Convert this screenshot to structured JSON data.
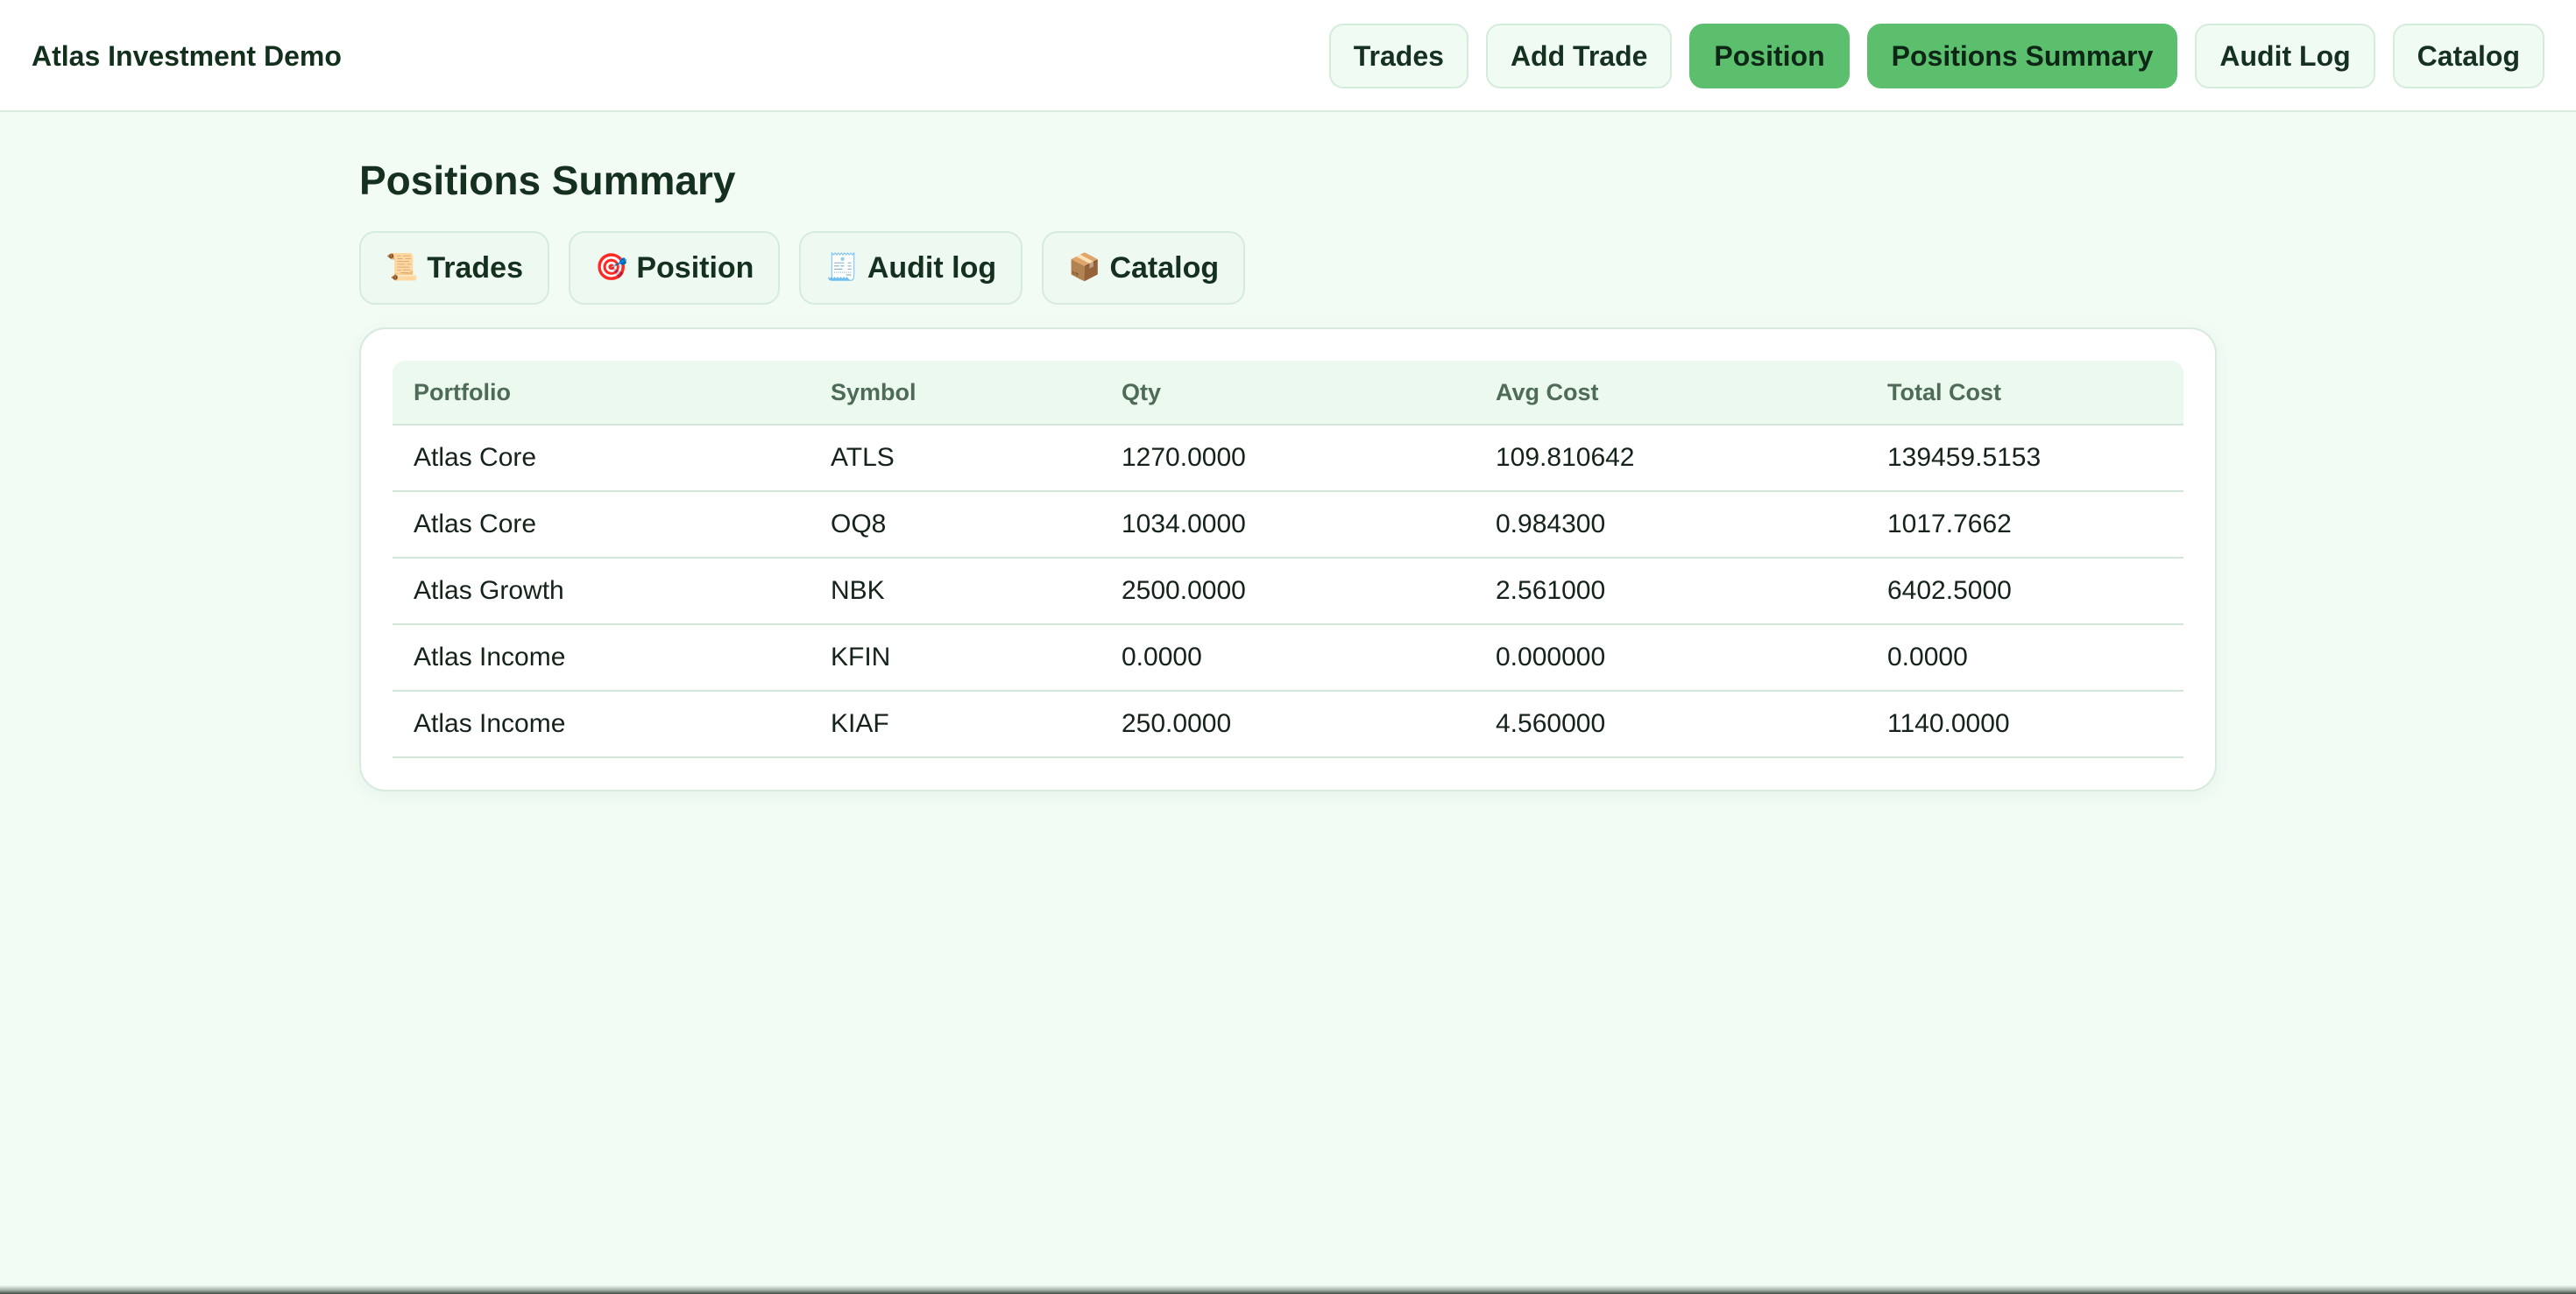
{
  "app": {
    "title": "Atlas Investment Demo"
  },
  "topnav": {
    "items": [
      {
        "label": "Trades",
        "active": false
      },
      {
        "label": "Add Trade",
        "active": false
      },
      {
        "label": "Position",
        "active": true
      },
      {
        "label": "Positions Summary",
        "active": true
      },
      {
        "label": "Audit Log",
        "active": false
      },
      {
        "label": "Catalog",
        "active": false
      }
    ]
  },
  "page": {
    "title": "Positions Summary"
  },
  "quicklinks": [
    {
      "icon": "scroll-icon",
      "emoji": "📜",
      "label": "Trades"
    },
    {
      "icon": "target-icon",
      "emoji": "🎯",
      "label": "Position"
    },
    {
      "icon": "receipt-icon",
      "emoji": "🧾",
      "label": "Audit log"
    },
    {
      "icon": "box-icon",
      "emoji": "📦",
      "label": "Catalog"
    }
  ],
  "table": {
    "columns": [
      "Portfolio",
      "Symbol",
      "Qty",
      "Avg Cost",
      "Total Cost"
    ],
    "rows": [
      [
        "Atlas Core",
        "ATLS",
        "1270.0000",
        "109.810642",
        "139459.5153"
      ],
      [
        "Atlas Core",
        "OQ8",
        "1034.0000",
        "0.984300",
        "1017.7662"
      ],
      [
        "Atlas Growth",
        "NBK",
        "2500.0000",
        "2.561000",
        "6402.5000"
      ],
      [
        "Atlas Income",
        "KFIN",
        "0.0000",
        "0.000000",
        "0.0000"
      ],
      [
        "Atlas Income",
        "KIAF",
        "250.0000",
        "4.560000",
        "1140.0000"
      ]
    ]
  },
  "colors": {
    "accent": "#5bbf6e",
    "background": "#f2fcf5",
    "header_row": "#ebf9ee"
  }
}
